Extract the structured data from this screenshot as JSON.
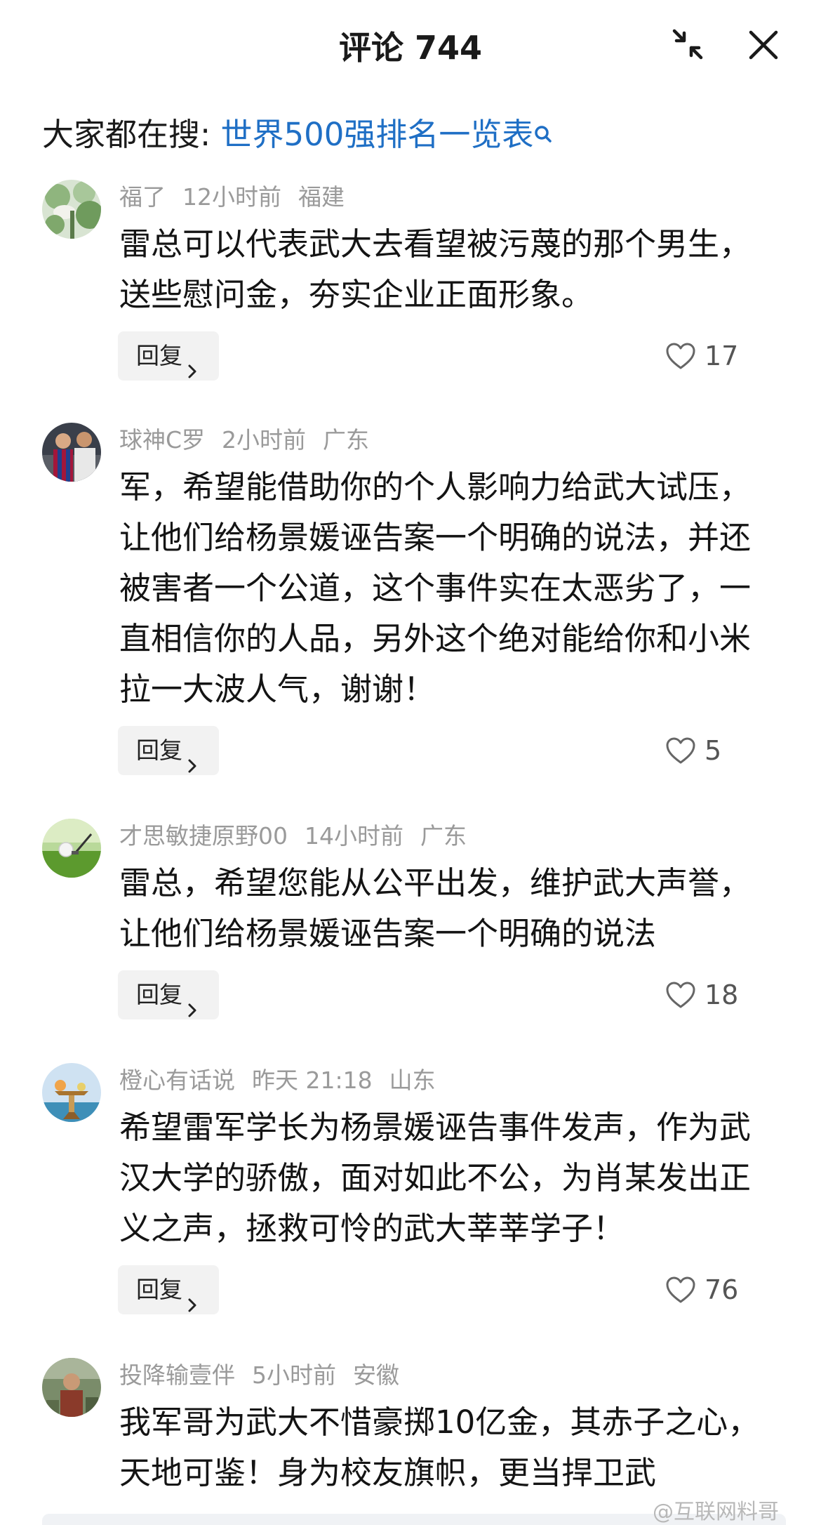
{
  "header": {
    "title": "评论 744"
  },
  "search": {
    "prefix": "大家都在搜:",
    "link": "世界500强排名一览表"
  },
  "reply_label": "回复",
  "comments": [
    {
      "user": "福了",
      "time": "12小时前",
      "location": "福建",
      "text": "雷总可以代表武大去看望被污蔑的那个男生，送些慰问金，夯实企业正面形象。",
      "likes": "17"
    },
    {
      "user": "球神C罗",
      "time": "2小时前",
      "location": "广东",
      "text": "军，希望能借助你的个人影响力给武大试压，让他们给杨景媛诬告案一个明确的说法，并还被害者一个公道，这个事件实在太恶劣了，一直相信你的人品，另外这个绝对能给你和小米拉一大波人气，谢谢！",
      "likes": "5"
    },
    {
      "user": "才思敏捷原野00",
      "time": "14小时前",
      "location": "广东",
      "text": "雷总，希望您能从公平出发，维护武大声誉，让他们给杨景媛诬告案一个明确的说法",
      "likes": "18"
    },
    {
      "user": "橙心有话说",
      "time": "昨天 21:18",
      "location": "山东",
      "text": "希望雷军学长为杨景媛诬告事件发声，作为武汉大学的骄傲，面对如此不公，为肖某发出正义之声，拯救可怜的武大莘莘学子！",
      "likes": "76"
    },
    {
      "user": "投降输壹伴",
      "time": "5小时前",
      "location": "安徽",
      "text": "我军哥为武大不惜豪掷10亿金，其赤子之心，天地可鉴！身为校友旗帜，更当捍卫武"
    }
  ],
  "watermark": "@互联网料哥",
  "colors": {
    "link": "#1f6fc5",
    "meta": "#9a9a9a",
    "reply_bg": "#f2f2f2"
  }
}
